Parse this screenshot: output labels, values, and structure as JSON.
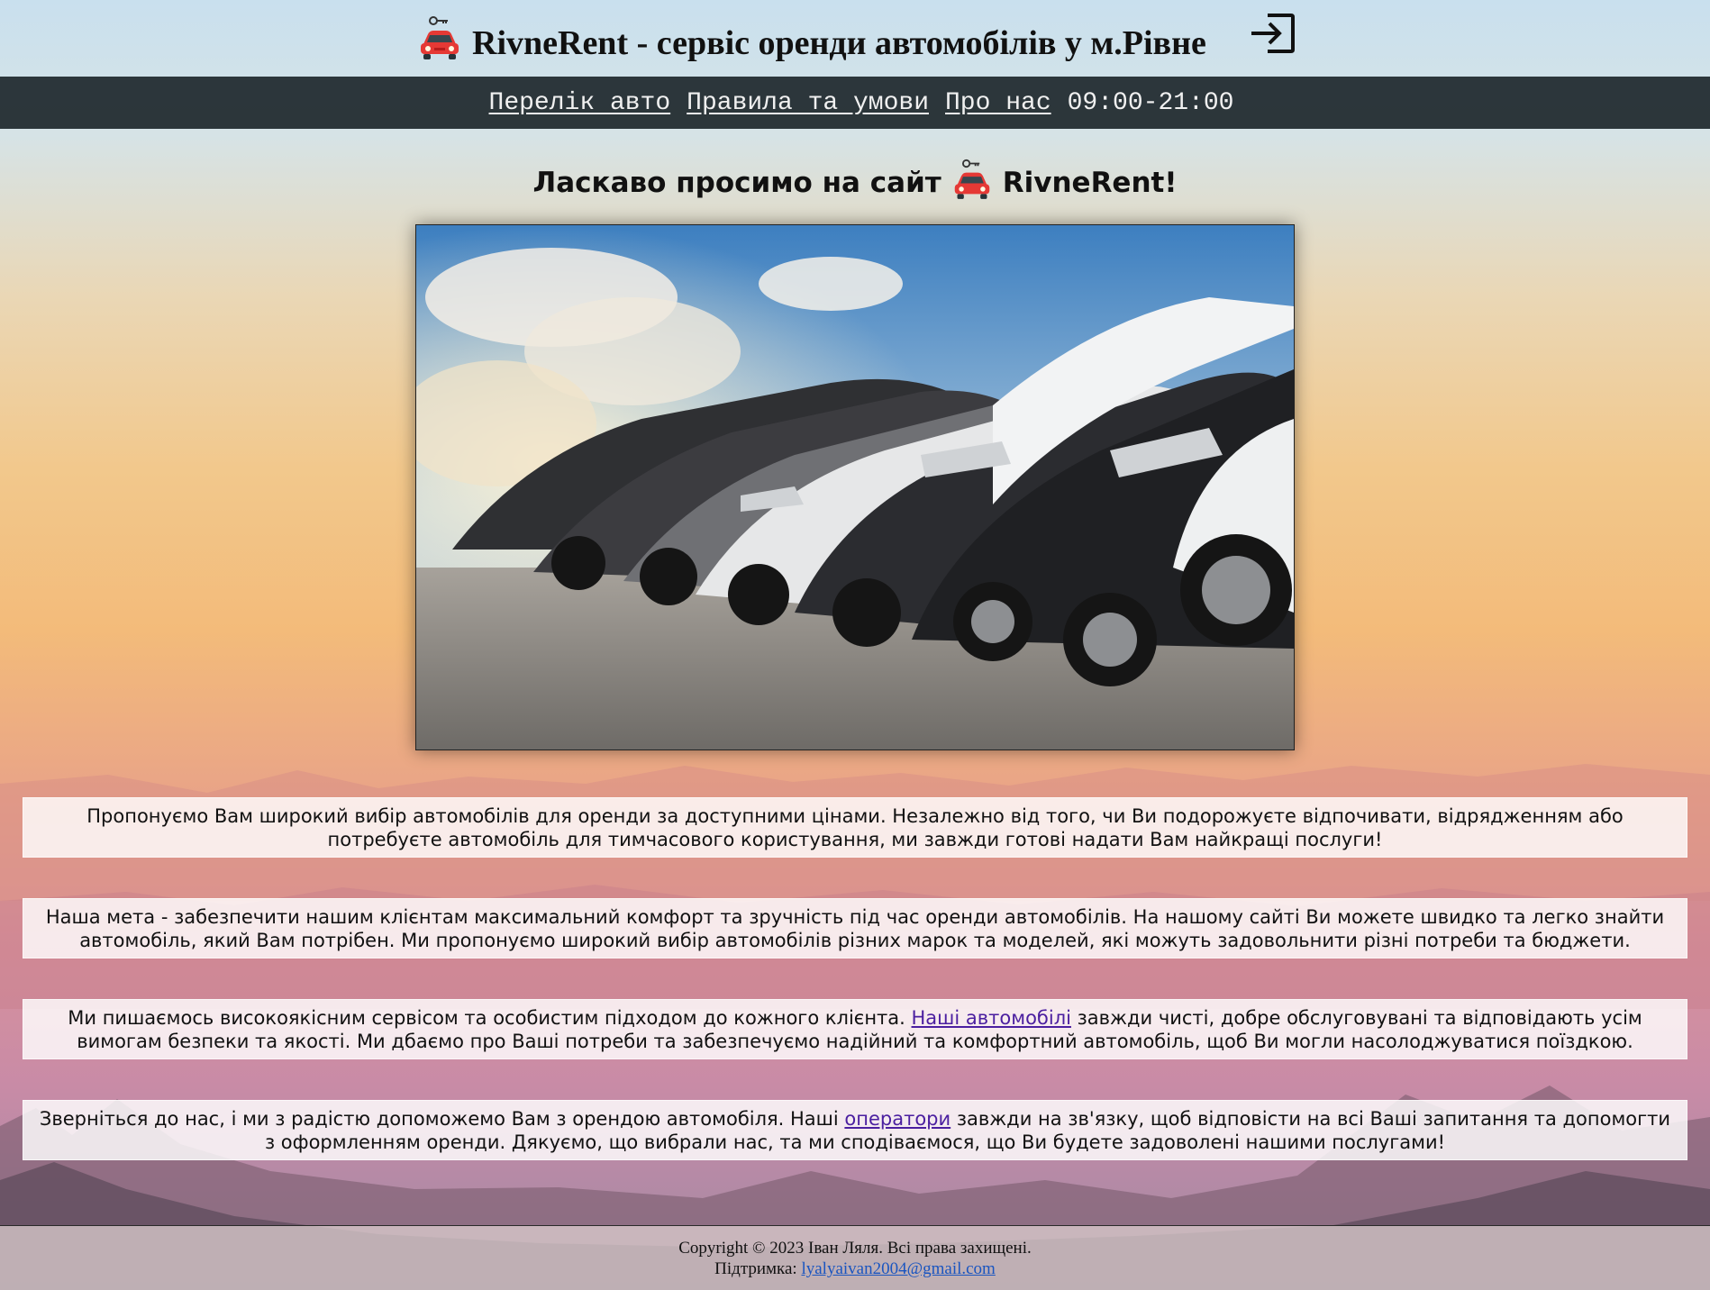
{
  "header": {
    "title": "RivneRent - сервіс оренди автомобілів у м.Рівне",
    "logo_icon": "car-with-key-icon",
    "login_icon": "sign-in-icon"
  },
  "nav": {
    "items": [
      {
        "label": "Перелік авто"
      },
      {
        "label": "Правила та умови"
      },
      {
        "label": "Про нас"
      }
    ],
    "hours": "09:00-21:00"
  },
  "main": {
    "welcome_before": "Ласкаво просимо на сайт",
    "welcome_after": "RivneRent!",
    "hero_image": "row-of-cars-photo",
    "paragraphs": [
      {
        "text": "Пропонуємо Вам широкий вибір автомобілів для оренди за доступними цінами. Незалежно від того, чи Ви подорожуєте відпочивати, відрядженням або потребуєте автомобіль для тимчасового користування, ми завжди готові надати Вам найкращі послуги!"
      },
      {
        "text": "Наша мета - забезпечити нашим клієнтам максимальний комфорт та зручність під час оренди автомобілів. На нашому сайті Ви можете швидко та легко знайти автомобіль, який Вам потрібен. Ми пропонуємо широкий вибір автомобілів різних марок та моделей, які можуть задовольнити різні потреби та бюджети."
      },
      {
        "before": "Ми пишаємось високоякісним сервісом та особистим підходом до кожного клієнта. ",
        "link": "Наші автомобілі",
        "after": " завжди чисті, добре обслуговувані та відповідають усім вимогам безпеки та якості. Ми дбаємо про Ваші потреби та забезпечуємо надійний та комфортний автомобіль, щоб Ви могли насолоджуватися поїздкою."
      },
      {
        "before": "Зверніться до нас, і ми з радістю допоможемо Вам з орендою автомобіля. Наші ",
        "link": "оператори",
        "after": " завжди на зв'язку, щоб відповісти на всі Ваші запитання та допомогти з оформленням оренди. Дякуємо, що вибрали нас, та ми сподіваємося, що Ви будете задоволені нашими послугами!"
      }
    ]
  },
  "footer": {
    "copyright": "Copyright © 2023 Іван Ляля. Всі права захищені.",
    "support_label": "Підтримка: ",
    "support_email": "lyalyaivan2004@gmail.com"
  },
  "colors": {
    "navbar_bg": "#141e22",
    "link": "#4b1fa0",
    "footer_link": "#1a55c0",
    "logo_red": "#e53935"
  }
}
